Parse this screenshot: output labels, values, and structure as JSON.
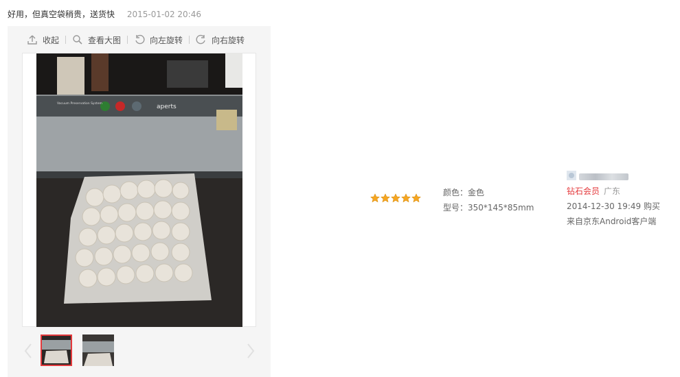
{
  "review": {
    "text": "好用，但真空袋稍贵，送货快",
    "date": "2015-01-02 20:46"
  },
  "viewer": {
    "toolbar": {
      "collapse": "收起",
      "view_large": "查看大图",
      "rotate_left": "向左旋转",
      "rotate_right": "向右旋转"
    },
    "photo": {
      "machine_brand": "aperts",
      "machine_caption": "Vacuum Preservation System"
    },
    "thumbnails_count": 2
  },
  "rating": {
    "stars": 5,
    "max": 5,
    "color": "#f5a623"
  },
  "product_attrs": [
    {
      "label": "颜色：",
      "value": "金色"
    },
    {
      "label": "型号：",
      "value": "350*145*85mm"
    }
  ],
  "user": {
    "level": "钻石会员",
    "region": "广东",
    "purchase_time": "2014-12-30 19:49",
    "purchase_label": "购买",
    "source": "来自京东Android客户端"
  },
  "colors": {
    "accent": "#e4393c",
    "muted": "#999999"
  }
}
